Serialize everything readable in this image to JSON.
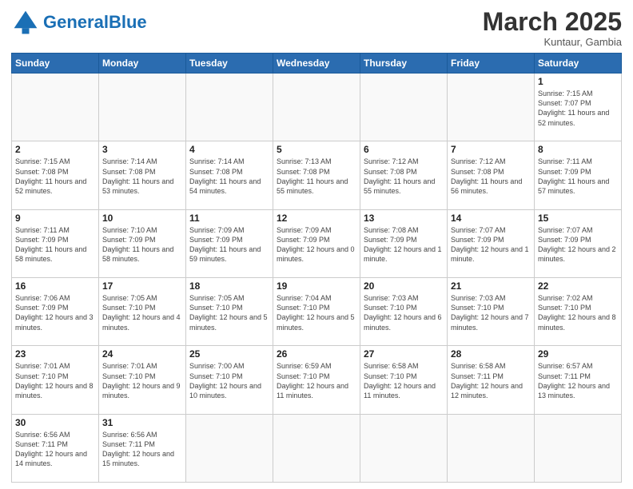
{
  "header": {
    "logo_general": "General",
    "logo_blue": "Blue",
    "month_title": "March 2025",
    "subtitle": "Kuntaur, Gambia"
  },
  "weekdays": [
    "Sunday",
    "Monday",
    "Tuesday",
    "Wednesday",
    "Thursday",
    "Friday",
    "Saturday"
  ],
  "weeks": [
    [
      {
        "day": "",
        "info": ""
      },
      {
        "day": "",
        "info": ""
      },
      {
        "day": "",
        "info": ""
      },
      {
        "day": "",
        "info": ""
      },
      {
        "day": "",
        "info": ""
      },
      {
        "day": "",
        "info": ""
      },
      {
        "day": "1",
        "info": "Sunrise: 7:15 AM\nSunset: 7:07 PM\nDaylight: 11 hours\nand 52 minutes."
      }
    ],
    [
      {
        "day": "2",
        "info": "Sunrise: 7:15 AM\nSunset: 7:08 PM\nDaylight: 11 hours\nand 52 minutes."
      },
      {
        "day": "3",
        "info": "Sunrise: 7:14 AM\nSunset: 7:08 PM\nDaylight: 11 hours\nand 53 minutes."
      },
      {
        "day": "4",
        "info": "Sunrise: 7:14 AM\nSunset: 7:08 PM\nDaylight: 11 hours\nand 54 minutes."
      },
      {
        "day": "5",
        "info": "Sunrise: 7:13 AM\nSunset: 7:08 PM\nDaylight: 11 hours\nand 55 minutes."
      },
      {
        "day": "6",
        "info": "Sunrise: 7:12 AM\nSunset: 7:08 PM\nDaylight: 11 hours\nand 55 minutes."
      },
      {
        "day": "7",
        "info": "Sunrise: 7:12 AM\nSunset: 7:08 PM\nDaylight: 11 hours\nand 56 minutes."
      },
      {
        "day": "8",
        "info": "Sunrise: 7:11 AM\nSunset: 7:09 PM\nDaylight: 11 hours\nand 57 minutes."
      }
    ],
    [
      {
        "day": "9",
        "info": "Sunrise: 7:11 AM\nSunset: 7:09 PM\nDaylight: 11 hours\nand 58 minutes."
      },
      {
        "day": "10",
        "info": "Sunrise: 7:10 AM\nSunset: 7:09 PM\nDaylight: 11 hours\nand 58 minutes."
      },
      {
        "day": "11",
        "info": "Sunrise: 7:09 AM\nSunset: 7:09 PM\nDaylight: 11 hours\nand 59 minutes."
      },
      {
        "day": "12",
        "info": "Sunrise: 7:09 AM\nSunset: 7:09 PM\nDaylight: 12 hours\nand 0 minutes."
      },
      {
        "day": "13",
        "info": "Sunrise: 7:08 AM\nSunset: 7:09 PM\nDaylight: 12 hours\nand 1 minute."
      },
      {
        "day": "14",
        "info": "Sunrise: 7:07 AM\nSunset: 7:09 PM\nDaylight: 12 hours\nand 1 minute."
      },
      {
        "day": "15",
        "info": "Sunrise: 7:07 AM\nSunset: 7:09 PM\nDaylight: 12 hours\nand 2 minutes."
      }
    ],
    [
      {
        "day": "16",
        "info": "Sunrise: 7:06 AM\nSunset: 7:09 PM\nDaylight: 12 hours\nand 3 minutes."
      },
      {
        "day": "17",
        "info": "Sunrise: 7:05 AM\nSunset: 7:10 PM\nDaylight: 12 hours\nand 4 minutes."
      },
      {
        "day": "18",
        "info": "Sunrise: 7:05 AM\nSunset: 7:10 PM\nDaylight: 12 hours\nand 5 minutes."
      },
      {
        "day": "19",
        "info": "Sunrise: 7:04 AM\nSunset: 7:10 PM\nDaylight: 12 hours\nand 5 minutes."
      },
      {
        "day": "20",
        "info": "Sunrise: 7:03 AM\nSunset: 7:10 PM\nDaylight: 12 hours\nand 6 minutes."
      },
      {
        "day": "21",
        "info": "Sunrise: 7:03 AM\nSunset: 7:10 PM\nDaylight: 12 hours\nand 7 minutes."
      },
      {
        "day": "22",
        "info": "Sunrise: 7:02 AM\nSunset: 7:10 PM\nDaylight: 12 hours\nand 8 minutes."
      }
    ],
    [
      {
        "day": "23",
        "info": "Sunrise: 7:01 AM\nSunset: 7:10 PM\nDaylight: 12 hours\nand 8 minutes."
      },
      {
        "day": "24",
        "info": "Sunrise: 7:01 AM\nSunset: 7:10 PM\nDaylight: 12 hours\nand 9 minutes."
      },
      {
        "day": "25",
        "info": "Sunrise: 7:00 AM\nSunset: 7:10 PM\nDaylight: 12 hours\nand 10 minutes."
      },
      {
        "day": "26",
        "info": "Sunrise: 6:59 AM\nSunset: 7:10 PM\nDaylight: 12 hours\nand 11 minutes."
      },
      {
        "day": "27",
        "info": "Sunrise: 6:58 AM\nSunset: 7:10 PM\nDaylight: 12 hours\nand 11 minutes."
      },
      {
        "day": "28",
        "info": "Sunrise: 6:58 AM\nSunset: 7:11 PM\nDaylight: 12 hours\nand 12 minutes."
      },
      {
        "day": "29",
        "info": "Sunrise: 6:57 AM\nSunset: 7:11 PM\nDaylight: 12 hours\nand 13 minutes."
      }
    ],
    [
      {
        "day": "30",
        "info": "Sunrise: 6:56 AM\nSunset: 7:11 PM\nDaylight: 12 hours\nand 14 minutes."
      },
      {
        "day": "31",
        "info": "Sunrise: 6:56 AM\nSunset: 7:11 PM\nDaylight: 12 hours\nand 15 minutes."
      },
      {
        "day": "",
        "info": ""
      },
      {
        "day": "",
        "info": ""
      },
      {
        "day": "",
        "info": ""
      },
      {
        "day": "",
        "info": ""
      },
      {
        "day": "",
        "info": ""
      }
    ]
  ]
}
